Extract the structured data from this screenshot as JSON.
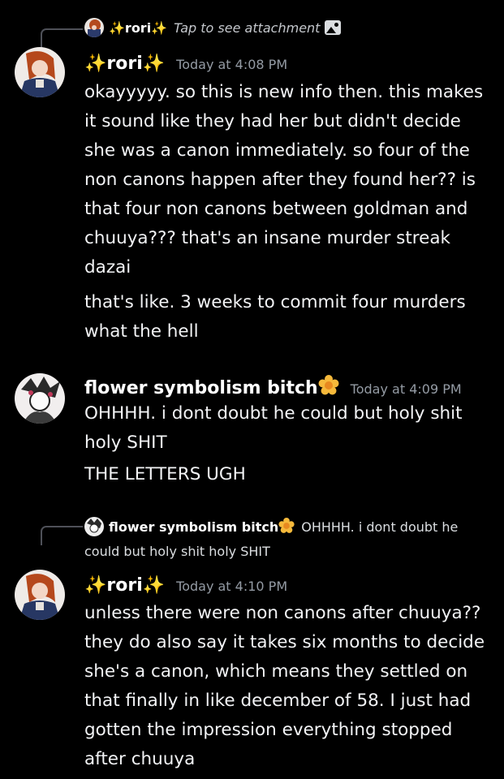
{
  "colors": {
    "background": "#000000",
    "text": "#f2f3f5",
    "muted": "#949ba4",
    "sparkle": "#f4c531",
    "flower": "#f6b93b"
  },
  "reply1": {
    "author": "✨rori✨",
    "preview": "Tap to see attachment",
    "icon": "image-icon"
  },
  "message1": {
    "author": "✨rori✨",
    "timestamp": "Today at 4:08 PM",
    "line1": "okayyyyy. so this is new info then. this makes it sound like they had her but didn't decide she was a canon immediately. so four of the non canons happen after they found her?? is that four non canons between goldman and chuuya??? that's an insane murder streak dazai",
    "line2": "that's like. 3 weeks to commit four murders what the hell"
  },
  "message2": {
    "author": "flower symbolism bitch",
    "author_emoji": "blossom-emoji",
    "timestamp": "Today at 4:09 PM",
    "line1": "OHHHH. i dont doubt he could but holy shit holy SHIT",
    "line2": "THE LETTERS UGH"
  },
  "reply2": {
    "author": "flower symbolism bitch",
    "author_emoji": "blossom-emoji",
    "preview": "OHHHH. i dont doubt he could but holy shit holy SHIT"
  },
  "message3": {
    "author": "✨rori✨",
    "timestamp": "Today at 4:10 PM",
    "line1": "unless there were non canons after chuuya?? they do also say it takes six months to decide she's a canon, which means they settled on that finally in like december of 58. I just had gotten the impression everything stopped after chuuya"
  }
}
